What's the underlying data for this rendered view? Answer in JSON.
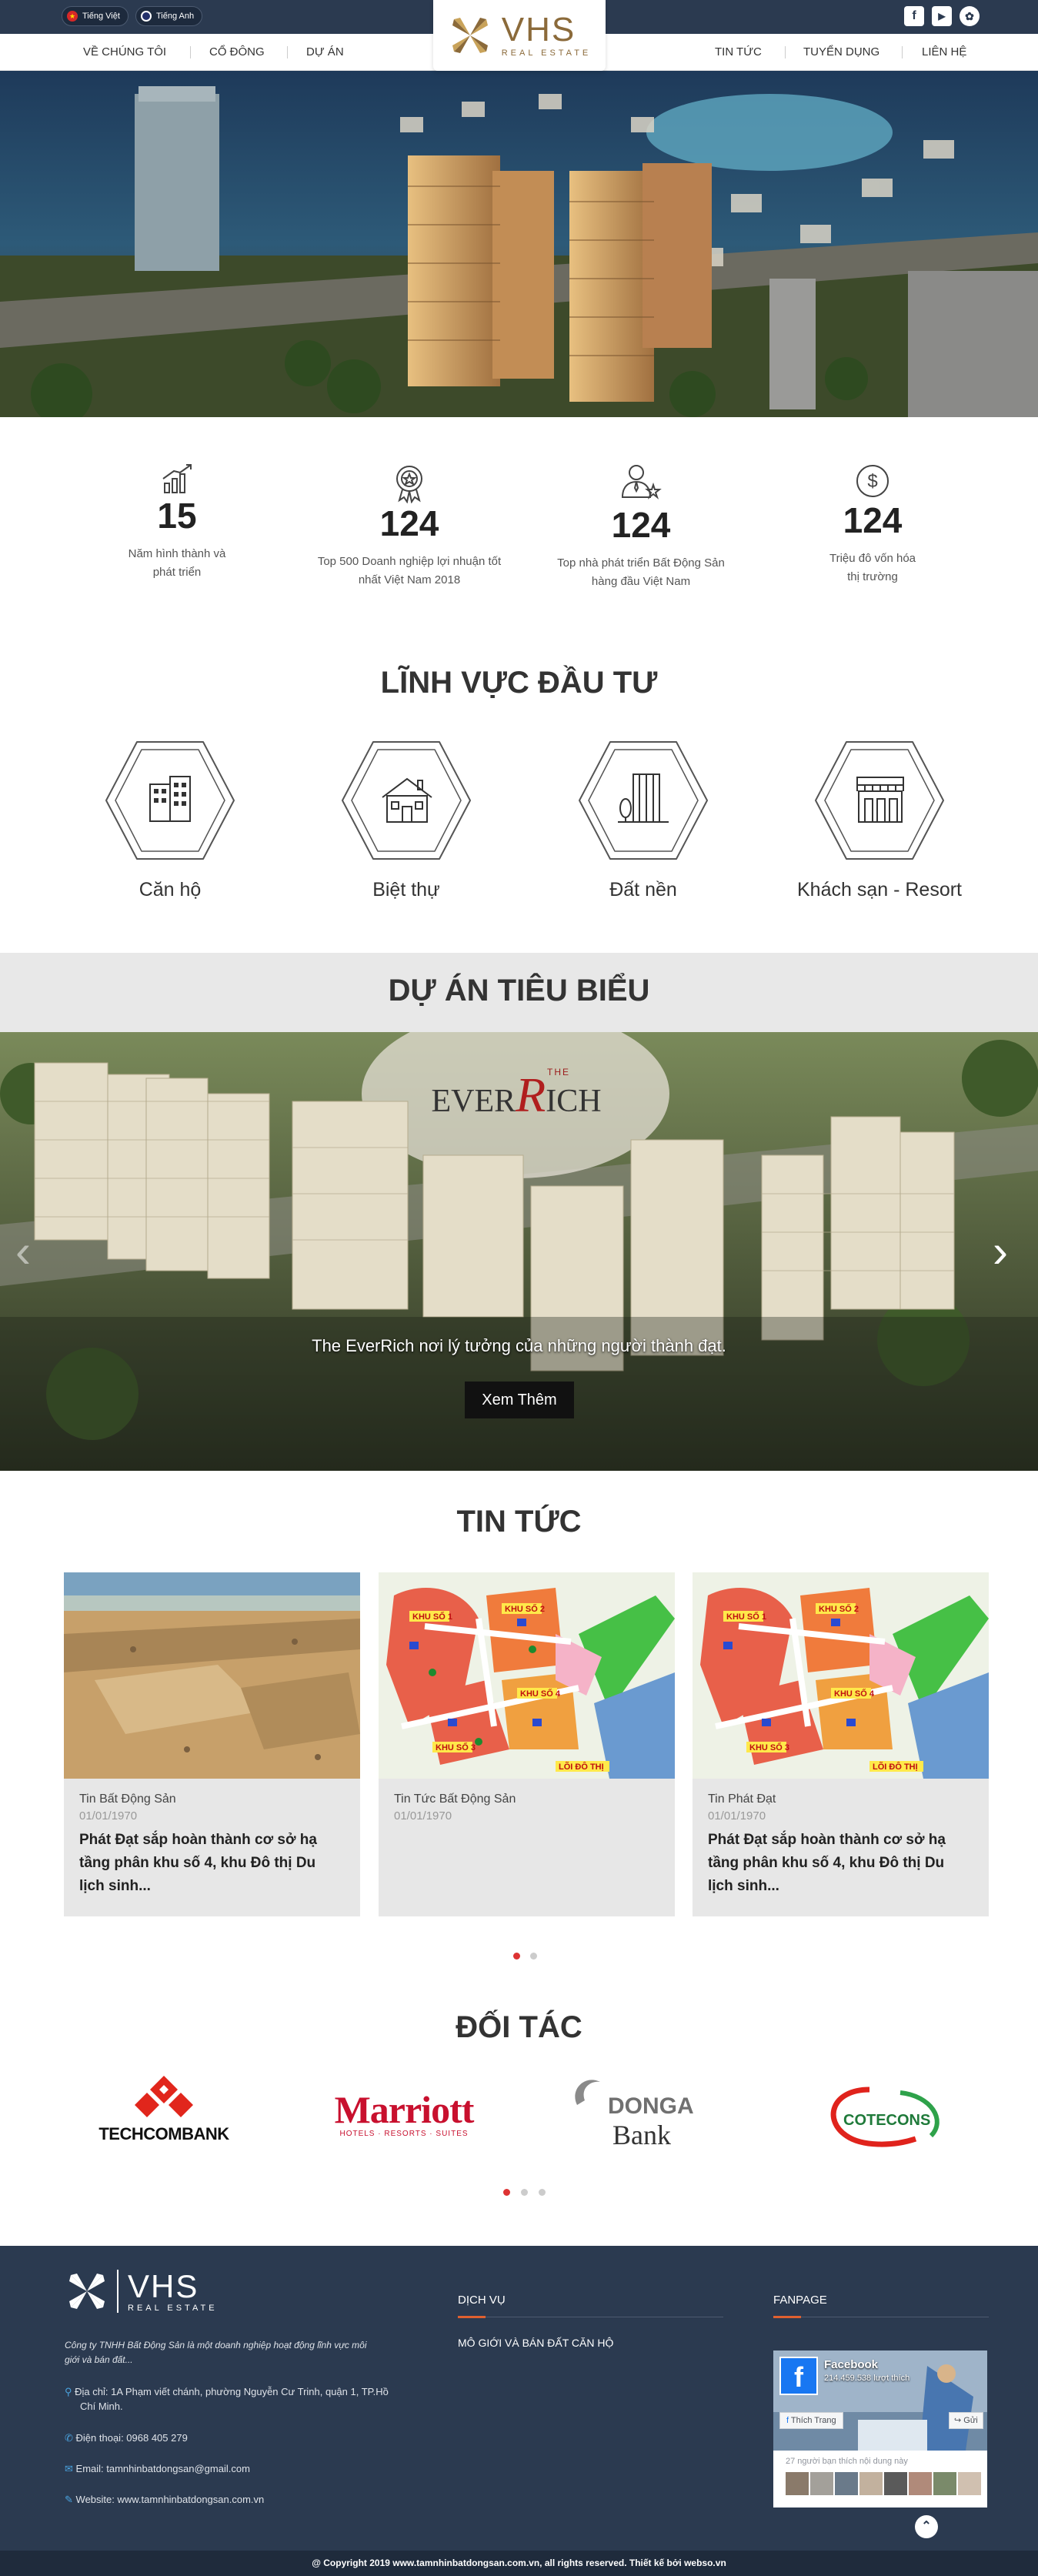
{
  "header": {
    "lang_vi": "Tiếng Việt",
    "lang_en": "Tiếng Anh",
    "logo_main": "VHS",
    "logo_sub": "REAL ESTATE",
    "social": [
      "f",
      "▶",
      "✿"
    ]
  },
  "nav": {
    "left": [
      "VỀ CHÚNG TÔI",
      "CỔ ĐÔNG",
      "DỰ ÁN"
    ],
    "right": [
      "TIN TỨC",
      "TUYỂN DỤNG",
      "LIÊN HỆ"
    ]
  },
  "stats": [
    {
      "num": "15",
      "label1": "Năm hình thành và",
      "label2": "phát triển"
    },
    {
      "num": "124",
      "label1": "Top 500 Doanh nghiệp lợi nhuận tốt",
      "label2": "nhất Việt Nam 2018"
    },
    {
      "num": "124",
      "label1": "Top nhà phát triển Bất Động Sản",
      "label2": "hàng đầu Việt Nam"
    },
    {
      "num": "124",
      "label1": "Triệu đô vốn hóa",
      "label2": "thị trường"
    }
  ],
  "fields": {
    "title": "LĨNH VỰC ĐẦU TƯ",
    "items": [
      "Căn hộ",
      "Biệt thự",
      "Đất nền",
      "Khách sạn - Resort"
    ]
  },
  "projects": {
    "title": "DỰ ÁN TIÊU BIỂU",
    "logo_the": "THE",
    "logo_name_a": "EVER",
    "logo_name_r": "R",
    "logo_name_b": "ICH",
    "caption": "The EverRich nơi lý tưởng của những người thành đạt.",
    "button": "Xem Thêm"
  },
  "news": {
    "title": "TIN TỨC",
    "items": [
      {
        "cat": "Tin Bất Động Sản",
        "date": "01/01/1970",
        "title": "Phát Đạt sắp hoàn thành cơ sở hạ tầng phân khu số 4, khu Đô thị Du lịch sinh..."
      },
      {
        "cat": "Tin Tức Bất Động Sản",
        "date": "01/01/1970",
        "title": ""
      },
      {
        "cat": "Tin Phát Đạt",
        "date": "01/01/1970",
        "title": "Phát Đạt sắp hoàn thành cơ sở hạ tầng phân khu số 4, khu Đô thị Du lịch sinh..."
      }
    ],
    "map_labels": [
      "KHU SỐ 1",
      "KHU SỐ 2",
      "KHU SỐ 4",
      "KHU SỐ 3",
      "LÕI ĐÔ THỊ"
    ]
  },
  "partners": {
    "title": "ĐỐI TÁC",
    "techcombank": "TECHCOMBANK",
    "marriott": "Marriott",
    "marriott_sub": "HOTELS · RESORTS · SUITES",
    "donga_1": "DONGA",
    "donga_2": "Bank",
    "cotecons": "COTECONS"
  },
  "footer": {
    "logo_main": "VHS",
    "logo_sub": "REAL ESTATE",
    "desc1": "Công ty TNHH Bất Động Sản là một doanh nghiệp hoạt động lĩnh vực môi",
    "desc2": "giới và bán đất...",
    "address1": "Địa chỉ: 1A Phạm viết chánh, phường Nguyễn Cư Trinh, quận 1, TP.Hồ",
    "address2": "Chí Minh.",
    "phone": "Điện thoại: 0968 405 279",
    "email": "Email: tamnhinbatdongsan@gmail.com",
    "website": "Website: www.tamnhinbatdongsan.com.vn",
    "services_title": "DỊCH VỤ",
    "service1": "MÔ GIỚI VÀ BÁN ĐẤT CĂN HỘ",
    "fanpage_title": "FANPAGE",
    "fb_name": "Facebook",
    "fb_likes": "214.459.538 lượt thích",
    "fb_like_btn": "Thích Trang",
    "fb_share": "Gửi",
    "fb_friends": "27 người bạn thích nội dung này",
    "copyright": "@ Copyright 2019 www.tamnhinbatdongsan.com.vn, all rights reserved. Thiết kế bởi webso.vn"
  },
  "colors": {
    "navy": "#2b3a50",
    "gold": "#8b6a3a",
    "gold_light": "#c9a35a",
    "card": "#e7e7e7"
  }
}
